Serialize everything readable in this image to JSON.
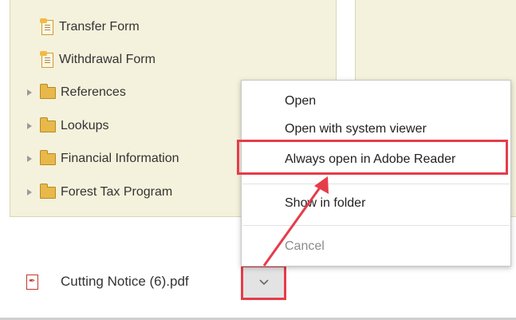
{
  "tree": {
    "items": [
      {
        "label": "Transfer Form",
        "icon": "form-icon"
      },
      {
        "label": "Withdrawal Form",
        "icon": "form-icon"
      },
      {
        "label": "References",
        "icon": "folder-icon"
      },
      {
        "label": "Lookups",
        "icon": "folder-icon"
      },
      {
        "label": "Financial Information",
        "icon": "folder-icon"
      },
      {
        "label": "Forest Tax Program",
        "icon": "folder-icon"
      }
    ]
  },
  "context_menu": {
    "open": "Open",
    "open_system_viewer": "Open with system viewer",
    "always_open": "Always open in Adobe Reader",
    "show_in_folder": "Show in folder",
    "cancel": "Cancel"
  },
  "download": {
    "filename": "Cutting Notice (6).pdf",
    "file_icon": "pdf-file-icon"
  },
  "colors": {
    "panel_bg": "#f4f2dc",
    "annotation_red": "#e63c4a",
    "folder": "#e8b84a"
  }
}
